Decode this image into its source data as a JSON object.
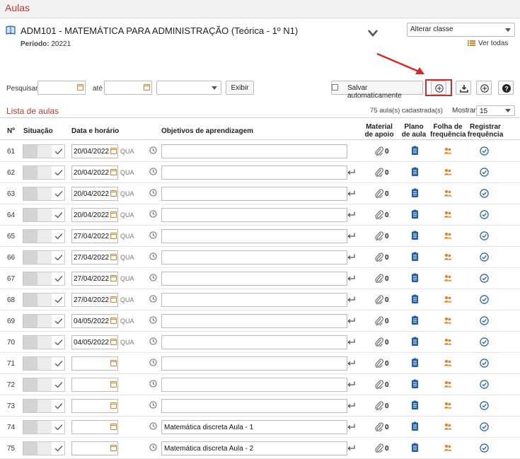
{
  "header": {
    "title": "Aulas"
  },
  "course": {
    "name": "ADM101 - MATEMÁTICA PARA ADMINISTRAÇÃO (Teórica - 1º N1)",
    "periodo_label": "Período:",
    "periodo_value": "20221",
    "alterar_classe": "Alterar classe",
    "ver_todas": "Ver todas"
  },
  "toolbar": {
    "pesquisar_label": "Pesquisar:",
    "ate_label": "até",
    "exibir_label": "Exibir",
    "salvar_label": "Salvar automaticamente"
  },
  "list": {
    "title": "Lista de aulas",
    "count": "75 aula(s) cadastrada(s)",
    "mostrar_label": "Mostrar",
    "mostrar_value": "15"
  },
  "columns": {
    "num": "Nº",
    "situacao": "Situação",
    "data": "Data e horário",
    "objetivos": "Objetivos de aprendizagem",
    "material1": "Material",
    "material2": "de apoio",
    "plano1": "Plano",
    "plano2": "de aula",
    "folha1": "Folha de",
    "folha2": "frequência",
    "registrar1": "Registrar",
    "registrar2": "frequência"
  },
  "rows": [
    {
      "num": "61",
      "date": "20/04/2022",
      "dow": "QUA",
      "obj": "",
      "mat": "0",
      "enter": false
    },
    {
      "num": "62",
      "date": "20/04/2022",
      "dow": "QUA",
      "obj": "",
      "mat": "0",
      "enter": true
    },
    {
      "num": "63",
      "date": "20/04/2022",
      "dow": "QUA",
      "obj": "",
      "mat": "0",
      "enter": true
    },
    {
      "num": "64",
      "date": "20/04/2022",
      "dow": "QUA",
      "obj": "",
      "mat": "0",
      "enter": true
    },
    {
      "num": "65",
      "date": "27/04/2022",
      "dow": "QUA",
      "obj": "",
      "mat": "0",
      "enter": true
    },
    {
      "num": "66",
      "date": "27/04/2022",
      "dow": "QUA",
      "obj": "",
      "mat": "0",
      "enter": true
    },
    {
      "num": "67",
      "date": "27/04/2022",
      "dow": "QUA",
      "obj": "",
      "mat": "0",
      "enter": true
    },
    {
      "num": "68",
      "date": "27/04/2022",
      "dow": "QUA",
      "obj": "",
      "mat": "0",
      "enter": true
    },
    {
      "num": "69",
      "date": "04/05/2022",
      "dow": "QUA",
      "obj": "",
      "mat": "0",
      "enter": true
    },
    {
      "num": "70",
      "date": "04/05/2022",
      "dow": "QUA",
      "obj": "",
      "mat": "0",
      "enter": true
    },
    {
      "num": "71",
      "date": "",
      "dow": "",
      "obj": "",
      "mat": "0",
      "enter": true
    },
    {
      "num": "72",
      "date": "",
      "dow": "",
      "obj": "",
      "mat": "0",
      "enter": true
    },
    {
      "num": "73",
      "date": "",
      "dow": "",
      "obj": "",
      "mat": "0",
      "enter": true
    },
    {
      "num": "74",
      "date": "",
      "dow": "",
      "obj": "Matemática discreta Aula - 1",
      "mat": "0",
      "enter": true
    },
    {
      "num": "75",
      "date": "",
      "dow": "",
      "obj": "Matemática discreta Aula - 2",
      "mat": "0",
      "enter": true
    }
  ],
  "colors": {
    "accent": "#c0392b",
    "orange": "#e67e22",
    "blue": "#1f5fa8",
    "highlight": "#d62828"
  }
}
